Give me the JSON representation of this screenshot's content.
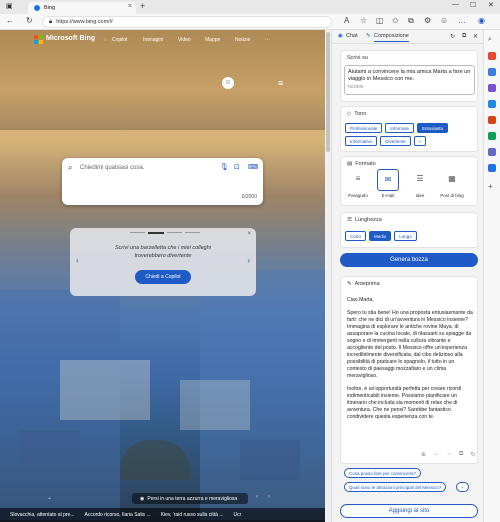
{
  "browser": {
    "tab_title": "Bing",
    "url": "https://www.bing.com/#"
  },
  "bing": {
    "brand": "Microsoft Bing",
    "nav": [
      "Copilot",
      "Immagini",
      "Video",
      "Mappe",
      "Notizie",
      "···"
    ],
    "search_placeholder": "Chiedimi qualsiasi cosa.",
    "char_counter": "0/2000",
    "promo_text": "Scrivi una barzelletta che i miei colleghi troverebbero divertente",
    "promo_button": "Chiedi a Copilot",
    "image_caption": "Persi in una terra azzurra e meravigliosa",
    "news": [
      "Slovacchia, attentato al pre...",
      "Accordo ricorso, Ilaria Salis ...",
      "Kiev, 'raid russo sulla città ...",
      "Ucr"
    ]
  },
  "panel": {
    "tab_chat": "Chat",
    "tab_compose": "Composizione",
    "write_about_label": "Scrivi su",
    "topic_text": "Aiutami a convincere la mia amica Marta a fare un viaggio in Messico con me.",
    "topic_count": "76/2000",
    "tone_label": "Tono",
    "tones": [
      "Professionale",
      "Informale",
      "Entusiasta",
      "Informativo",
      "Divertente",
      "+"
    ],
    "format_label": "Formato",
    "formats": [
      "Paragrafo",
      "E-mail",
      "Idee",
      "Post di blog"
    ],
    "length_label": "Lunghezza",
    "lengths": [
      "Corto",
      "Medio",
      "Lungo"
    ],
    "generate_button": "Genera bozza",
    "preview_label": "Anteprima",
    "preview_paragraphs": [
      "Ciao Marta,",
      "Spero tu stia bene! Ho una proposta entusiasmante da farti: che ne dici di un'avventura in Messico insieme? Immagina di esplorare le antiche rovine Maya, di assaporare la cucina locale, di rilassarti su spiagge da sogno e di immergerti nella cultura vibrante e accogliente del posto. Il Messico offre un'esperienza incredibilmente diversificata, dal cibo delizioso alla possibilità di praticare lo spagnolo, il tutto in un contesto di paesaggi mozzafiato e un clima meraviglioso.",
      "Inoltre, è un'opportunità perfetta per creare ricordi indimenticabili insieme. Possiamo pianificare un itinerario che includa sia momenti di relax che di avventura. Che ne pensi? Sarebbe fantastico condividere questa esperienza con te."
    ],
    "suggestions": [
      "Cosa posso fare per convincerla?",
      "Quali sono le attrazioni principali del Messico?",
      "+"
    ],
    "add_button": "Aggiungi al sito"
  },
  "colors": {
    "accent": "#1e5bc6"
  }
}
